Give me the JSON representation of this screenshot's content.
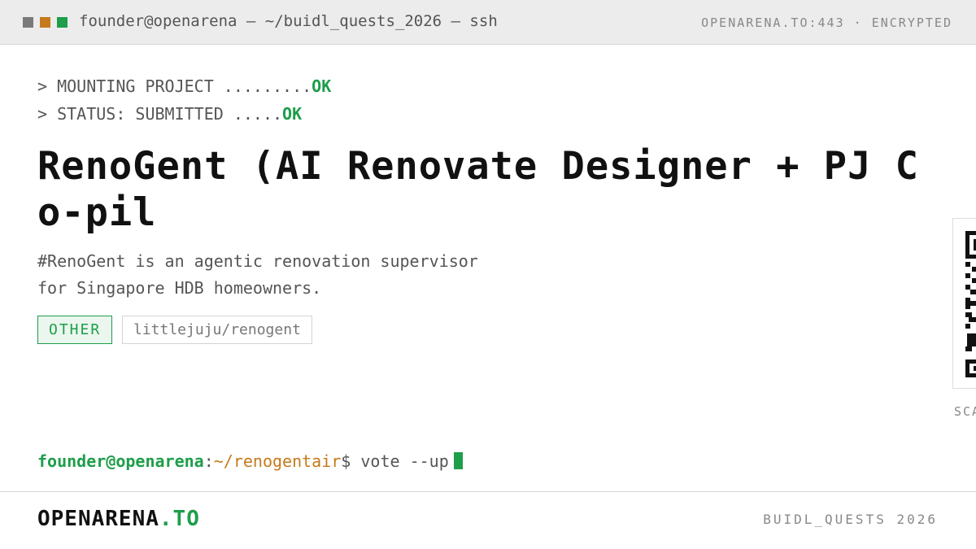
{
  "window": {
    "title": "founder@openarena — ~/buidl_quests_2026 — ssh",
    "connection": "OPENARENA.TO:443 · ENCRYPTED"
  },
  "boot": [
    {
      "text": "> MOUNTING PROJECT .........",
      "status": "OK"
    },
    {
      "text": "> STATUS: SUBMITTED .....",
      "status": "OK"
    }
  ],
  "project": {
    "title": "RenoGent (AI Renovate Designer + PJ Co-pil",
    "description": "#RenoGent is an agentic renovation supervisor\n for Singapore HDB homeowners.",
    "category": "OTHER",
    "repo": "littlejuju/renogent"
  },
  "qr": {
    "label": "SCAN"
  },
  "prompt": {
    "user": "founder@openarena",
    "separator": ":",
    "path": "~/renogentair",
    "dollar": "$",
    "command": "vote --up"
  },
  "footer": {
    "brand_main": "OPENARENA",
    "brand_accent": ".TO",
    "event": "BUIDL_QUESTS 2026"
  },
  "colors": {
    "accent": "#1e9e4a",
    "path": "#c57a1c",
    "muted": "#555555"
  }
}
